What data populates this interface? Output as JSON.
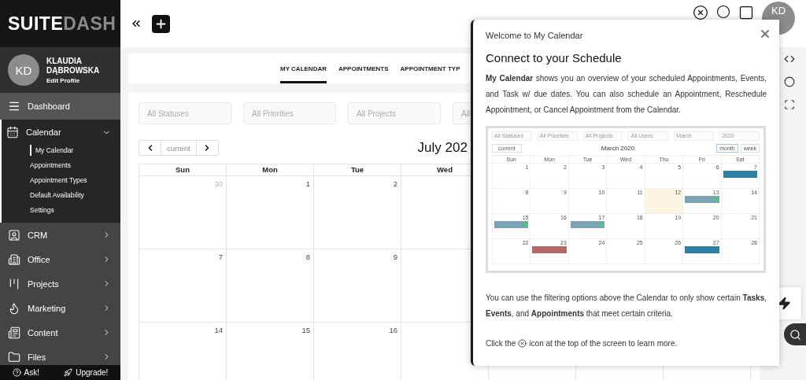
{
  "sidebar": {
    "logo": [
      "SUITE",
      "DASH"
    ],
    "profile": {
      "initials": "KD",
      "name": "KLAUDIA DĄBROWSKA",
      "link": "Edit Profile"
    },
    "home_link": {
      "label": "Dashboard"
    },
    "menu": [
      {
        "label": "Calendar",
        "expanded": true,
        "children": [
          {
            "label": "My Calendar",
            "selected": true
          },
          {
            "label": "Appointments",
            "selected": false
          },
          {
            "label": "Appointment Types",
            "selected": false
          },
          {
            "label": "Default Availability",
            "selected": false
          },
          {
            "label": "Settings",
            "selected": false
          }
        ]
      },
      {
        "label": "CRM",
        "expanded": false
      },
      {
        "label": "Office",
        "expanded": false
      },
      {
        "label": "Projects",
        "expanded": false
      },
      {
        "label": "Marketing",
        "expanded": false
      },
      {
        "label": "Content",
        "expanded": false
      },
      {
        "label": "Files",
        "expanded": false
      }
    ],
    "footer": [
      "Ask!",
      "Upgrade!"
    ]
  },
  "topbar": {
    "avatar": "KD"
  },
  "tabs": [
    {
      "label": "MY CALENDAR",
      "selected": true
    },
    {
      "label": "APPOINTMENTS",
      "selected": false
    },
    {
      "label": "APPOINTMENT TYP",
      "selected": false
    }
  ],
  "filters": [
    {
      "placeholder": "All Statuses"
    },
    {
      "placeholder": "All Priorities"
    },
    {
      "placeholder": "All Projects"
    },
    {
      "placeholder": "All"
    }
  ],
  "calendar": {
    "nav": "current",
    "title": "July 202",
    "weekdays": [
      "Sun",
      "Mon",
      "Tue",
      "Wed"
    ],
    "weeks": [
      [
        {
          "day": "30",
          "muted": true
        },
        {
          "day": "1",
          "muted": false
        },
        {
          "day": "2",
          "muted": false
        }
      ],
      [
        {
          "day": "7",
          "muted": false
        },
        {
          "day": "8",
          "muted": false
        },
        {
          "day": "9",
          "muted": false
        }
      ],
      [
        {
          "day": "14",
          "muted": false
        },
        {
          "day": "15",
          "muted": false
        },
        {
          "day": "16",
          "muted": false
        }
      ]
    ]
  },
  "modal": {
    "kicker": "Welcome to My Calendar",
    "title": "Connect to your Schedule",
    "intro": "**My Calendar** shows you an overview of your scheduled Appointments, Events, and Task w/ due dates. You can also schedule an Appointment, Reschedule Appointment, or Cancel Appointment from the Calendar.",
    "preview": {
      "filters": [
        "All Statuses",
        "All Priorities",
        "All Projects",
        "All Users",
        "March",
        "2020"
      ],
      "nav": "current",
      "title": "March 2020",
      "views": [
        {
          "label": "month",
          "selected": true
        },
        {
          "label": "week",
          "selected": false
        }
      ],
      "weekdays": [
        "Sun",
        "Mon",
        "Tue",
        "Wed",
        "Thu",
        "Fri",
        "Sat"
      ],
      "weeks": [
        [
          {
            "day": "1",
            "today": false
          },
          {
            "day": "2",
            "today": false
          },
          {
            "day": "3",
            "today": false
          },
          {
            "day": "4",
            "today": false
          },
          {
            "day": "5",
            "today": false
          },
          {
            "day": "6",
            "today": false
          },
          {
            "day": "7",
            "today": false,
            "color": "#2f7fa6"
          }
        ],
        [
          {
            "day": "8",
            "today": false
          },
          {
            "day": "9",
            "today": false
          },
          {
            "day": "10",
            "today": false
          },
          {
            "day": "11",
            "today": false
          },
          {
            "day": "12",
            "today": true
          },
          {
            "day": "13",
            "today": false,
            "color": "#7ba3b5",
            "dot": true
          },
          {
            "day": "14",
            "today": false
          }
        ],
        [
          {
            "day": "15",
            "today": false,
            "color": "#7ba3b5",
            "dot": true
          },
          {
            "day": "16",
            "today": false
          },
          {
            "day": "17",
            "today": false,
            "color": "#7ba3b5",
            "dot": true
          },
          {
            "day": "18",
            "today": false
          },
          {
            "day": "19",
            "today": false
          },
          {
            "day": "20",
            "today": false
          },
          {
            "day": "21",
            "today": false
          }
        ],
        [
          {
            "day": "22",
            "today": false
          },
          {
            "day": "23",
            "today": false,
            "color": "#b56a6a"
          },
          {
            "day": "24",
            "today": false
          },
          {
            "day": "25",
            "today": false
          },
          {
            "day": "26",
            "today": false
          },
          {
            "day": "27",
            "today": false,
            "color": "#2f7fa6"
          },
          {
            "day": "28",
            "today": false
          }
        ]
      ]
    },
    "filter_text": "You can use the filtering options above the Calendar to only show certain **Tasks**, **Events**, and **Appointments** that meet certain criteria.",
    "help_text": {
      "before": "Click the",
      "after": "icon at the top of the screen to learn more."
    }
  }
}
